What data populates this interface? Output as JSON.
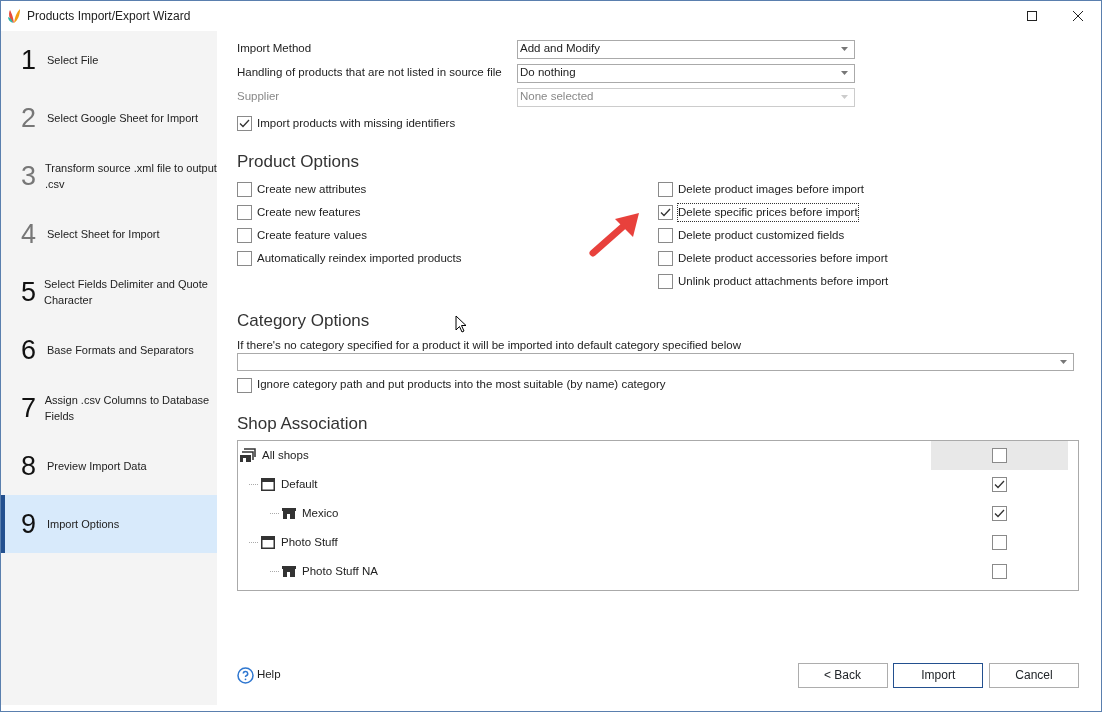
{
  "window": {
    "title": "Products Import/Export Wizard"
  },
  "steps": [
    {
      "number": "1",
      "label": "Select File",
      "disabled": false,
      "selected": false
    },
    {
      "number": "2",
      "label": "Select Google Sheet for Import",
      "disabled": true,
      "selected": false
    },
    {
      "number": "3",
      "label": "Transform source .xml file to output .csv",
      "disabled": true,
      "selected": false
    },
    {
      "number": "4",
      "label": "Select Sheet for Import",
      "disabled": true,
      "selected": false
    },
    {
      "number": "5",
      "label": "Select Fields Delimiter and Quote Character",
      "disabled": false,
      "selected": false
    },
    {
      "number": "6",
      "label": "Base Formats and Separators",
      "disabled": false,
      "selected": false
    },
    {
      "number": "7",
      "label": "Assign .csv Columns to Database Fields",
      "disabled": false,
      "selected": false
    },
    {
      "number": "8",
      "label": "Preview Import Data",
      "disabled": false,
      "selected": false
    },
    {
      "number": "9",
      "label": "Import Options",
      "disabled": false,
      "selected": true
    }
  ],
  "fields": [
    {
      "label": "Import Method",
      "value": "Add and Modify",
      "disabled": false
    },
    {
      "label": "Handling of products that are not listed in source file",
      "value": "Do nothing",
      "disabled": false
    },
    {
      "label": "Supplier",
      "value": "None selected",
      "disabled": true
    }
  ],
  "import_missing_identifiers": {
    "label": "Import products with missing identifiers",
    "checked": true
  },
  "product_options": {
    "title": "Product Options",
    "left": [
      {
        "label": "Create new attributes",
        "checked": false,
        "focused": false
      },
      {
        "label": "Create new features",
        "checked": false,
        "focused": false
      },
      {
        "label": "Create feature values",
        "checked": false,
        "focused": false
      },
      {
        "label": "Automatically reindex imported products",
        "checked": false,
        "focused": false
      }
    ],
    "right": [
      {
        "label": "Delete product images before import",
        "checked": false,
        "focused": false
      },
      {
        "label": "Delete specific prices before import",
        "checked": true,
        "focused": true
      },
      {
        "label": "Delete product customized fields",
        "checked": false,
        "focused": false
      },
      {
        "label": "Delete product accessories before import",
        "checked": false,
        "focused": false
      },
      {
        "label": "Unlink product attachments before import",
        "checked": false,
        "focused": false
      }
    ]
  },
  "category_options": {
    "title": "Category Options",
    "hint": "If there's no category specified for a product it will be imported into default category specified below",
    "ignore_path": {
      "label": "Ignore category path and put products into the most suitable (by name) category",
      "checked": false
    }
  },
  "shop_association": {
    "title": "Shop Association",
    "tree": [
      {
        "kind": "all",
        "label": "All shops",
        "checked": false,
        "selected": true,
        "children": [
          {
            "kind": "group",
            "label": "Default",
            "checked": true,
            "selected": false,
            "children": [
              {
                "kind": "shop",
                "label": "Mexico",
                "checked": true,
                "selected": false
              }
            ]
          },
          {
            "kind": "group",
            "label": "Photo Stuff",
            "checked": false,
            "selected": false,
            "children": [
              {
                "kind": "shop",
                "label": "Photo Stuff NA",
                "checked": false,
                "selected": false
              }
            ]
          }
        ]
      }
    ]
  },
  "help": "Help",
  "buttons": [
    {
      "label": "< Back",
      "default": false
    },
    {
      "label": "Import",
      "default": true
    },
    {
      "label": "Cancel",
      "default": false
    }
  ]
}
